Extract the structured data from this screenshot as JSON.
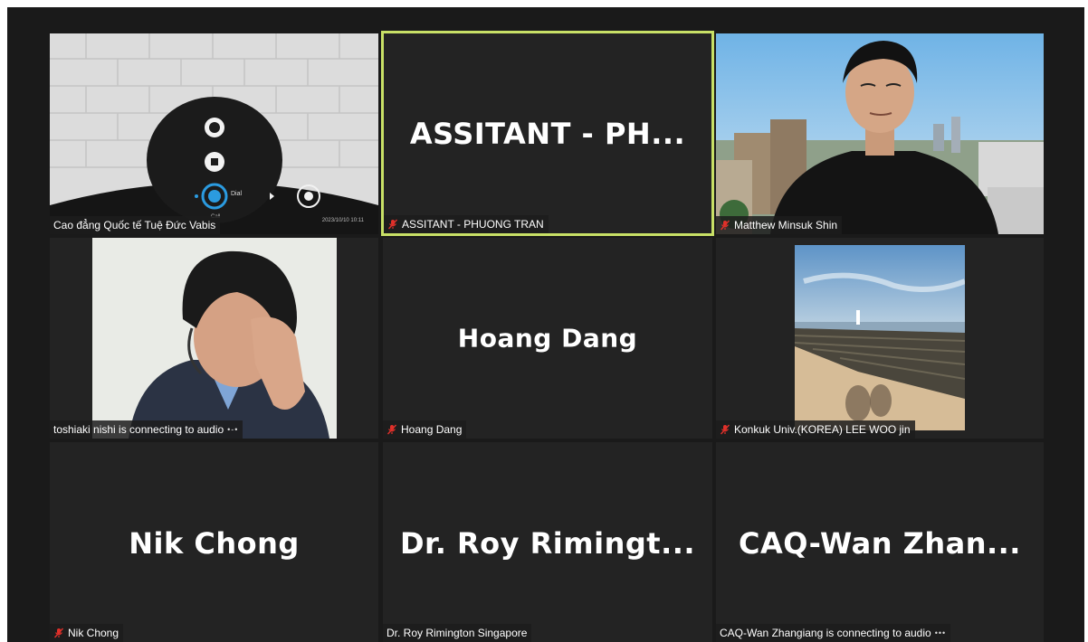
{
  "participants": [
    {
      "label": "Cao đẳng Quốc tế Tuệ Đức Vabis",
      "muted": false,
      "active": false,
      "big_name": "",
      "device": {
        "dial_label": "Dial",
        "call_label": "Call",
        "timestamp": "2023/10/10 10:11"
      }
    },
    {
      "label": "ASSITANT - PHUONG TRAN",
      "muted": true,
      "active": true,
      "big_name": "ASSITANT  - PH..."
    },
    {
      "label": "Matthew Minsuk Shin",
      "muted": true,
      "active": false,
      "big_name": ""
    },
    {
      "label": "toshiaki nishi is connecting to audio",
      "muted": false,
      "active": false,
      "big_name": "",
      "connecting_icon": "•-•"
    },
    {
      "label": "Hoang Dang",
      "muted": true,
      "active": false,
      "big_name": "Hoang Dang"
    },
    {
      "label": "Konkuk Univ.(KOREA) LEE WOO jin",
      "muted": true,
      "active": false,
      "big_name": ""
    },
    {
      "label": "Nik Chong",
      "muted": true,
      "active": false,
      "big_name": "Nik Chong"
    },
    {
      "label": "Dr. Roy Rimington Singapore",
      "muted": false,
      "active": false,
      "big_name": "Dr. Roy Rimingt..."
    },
    {
      "label": "CAQ-Wan Zhangiang is connecting to audio",
      "muted": false,
      "active": false,
      "big_name": "CAQ-Wan  Zhan...",
      "connecting_icon": "•••"
    }
  ],
  "colors": {
    "active_border": "#c8e066",
    "muted": "#e0302a",
    "tile_bg": "#232323"
  }
}
